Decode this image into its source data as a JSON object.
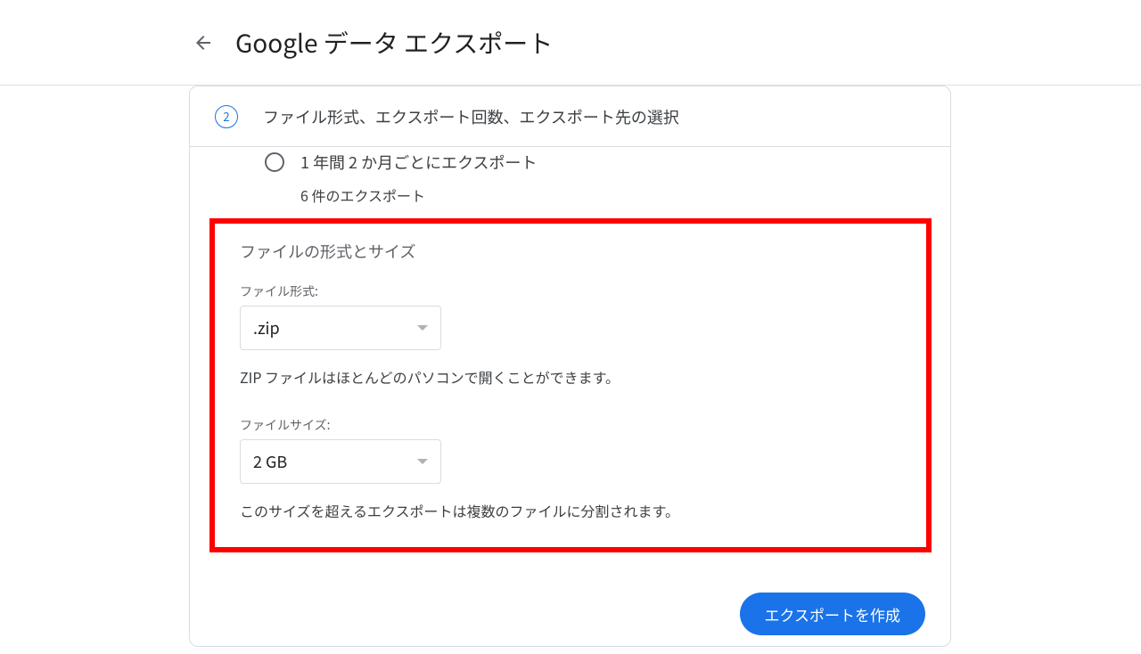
{
  "header": {
    "title": "Google データ エクスポート"
  },
  "step": {
    "number": "2",
    "title": "ファイル形式、エクスポート回数、エクスポート先の選択"
  },
  "frequency": {
    "option_periodic": "1 年間 2 か月ごとにエクスポート",
    "detail": "6 件のエクスポート"
  },
  "form": {
    "section_title": "ファイルの形式とサイズ",
    "file_type_label": "ファイル形式:",
    "file_type_value": ".zip",
    "file_type_help": "ZIP ファイルはほとんどのパソコンで開くことができます。",
    "file_size_label": "ファイルサイズ:",
    "file_size_value": "2 GB",
    "file_size_help": "このサイズを超えるエクスポートは複数のファイルに分割されます。"
  },
  "footer": {
    "create_export": "エクスポートを作成"
  }
}
